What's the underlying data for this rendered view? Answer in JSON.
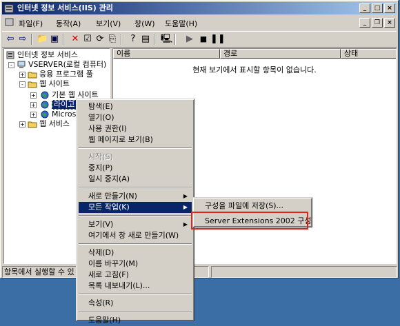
{
  "window": {
    "title": "인터넷 정보 서비스(IIS) 관리"
  },
  "menubar": [
    "파일(F)",
    "동작(A)",
    "보기(V)",
    "창(W)",
    "도움말(H)"
  ],
  "tree": [
    {
      "label": "인터넷 정보 서비스",
      "icon": "iis-icon"
    },
    {
      "label": "VSERVER(로컬 컴퓨터)",
      "icon": "computer-icon",
      "expander": "-"
    },
    {
      "label": "응용 프로그램 풀",
      "icon": "folder-icon",
      "expander": "+"
    },
    {
      "label": "웹 사이트",
      "icon": "folder-icon",
      "expander": "-"
    },
    {
      "label": "기본 웹 사이트",
      "icon": "globe-icon",
      "expander": "+"
    },
    {
      "label": "라이고",
      "icon": "globe-icon",
      "expander": "+"
    },
    {
      "label": "Micros",
      "icon": "globe-icon",
      "expander": "+"
    },
    {
      "label": "웹 서비스",
      "icon": "folder-icon",
      "expander": "+"
    }
  ],
  "list": {
    "columns": [
      "이름",
      "경로",
      "상태"
    ],
    "empty_message": "현재 보기에서 표시할 항목이 없습니다."
  },
  "status_text": "항목에서 실행할 수 있",
  "context_menu": [
    {
      "label": "탐색(E)"
    },
    {
      "label": "열기(O)"
    },
    {
      "label": "사용 권한(I)"
    },
    {
      "label": "웹 페이지로 보기(B)"
    },
    {
      "sep": true
    },
    {
      "label": "시작(S)",
      "disabled": true
    },
    {
      "label": "중지(P)"
    },
    {
      "label": "일시 중지(A)"
    },
    {
      "sep": true
    },
    {
      "label": "새로 만들기(N)",
      "submenu": true
    },
    {
      "label": "모든 작업(K)",
      "submenu": true,
      "selected": true
    },
    {
      "sep": true
    },
    {
      "label": "보기(V)",
      "submenu": true
    },
    {
      "label": "여기에서 창 새로 만들기(W)"
    },
    {
      "sep": true
    },
    {
      "label": "삭제(D)"
    },
    {
      "label": "이름 바꾸기(M)"
    },
    {
      "label": "새로 고침(F)"
    },
    {
      "label": "목록 내보내기(L)..."
    },
    {
      "sep": true
    },
    {
      "label": "속성(R)"
    },
    {
      "sep": true
    },
    {
      "label": "도움말(H)"
    }
  ],
  "submenu": [
    {
      "label": "구성을 파일에 저장(S)..."
    },
    {
      "label": "Server Extensions 2002 구성",
      "highlighted": true
    }
  ],
  "colors": {
    "title_start": "#0a246a",
    "title_end": "#a6caf0",
    "highlight_box": "#e0241c",
    "selection": "#0a246a",
    "desktop": "#3a6ea5"
  }
}
